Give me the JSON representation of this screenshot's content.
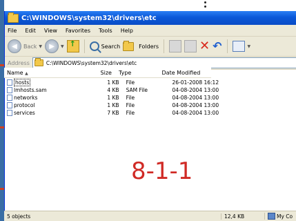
{
  "window": {
    "title": "C:\\WINDOWS\\system32\\drivers\\etc"
  },
  "menu": [
    "File",
    "Edit",
    "View",
    "Favorites",
    "Tools",
    "Help"
  ],
  "toolbar": {
    "back_label": "Back",
    "search_label": "Search",
    "folders_label": "Folders"
  },
  "address": {
    "label": "Address",
    "value": "C:\\WINDOWS\\system32\\drivers\\etc"
  },
  "columns": {
    "name": "Name",
    "size": "Size",
    "type": "Type",
    "date": "Date Modified"
  },
  "files": [
    {
      "name": "hosts",
      "size": "1 KB",
      "type": "File",
      "date": "26-01-2008 16:12"
    },
    {
      "name": "lmhosts.sam",
      "size": "4 KB",
      "type": "SAM File",
      "date": "04-08-2004 13:00"
    },
    {
      "name": "networks",
      "size": "1 KB",
      "type": "File",
      "date": "04-08-2004 13:00"
    },
    {
      "name": "protocol",
      "size": "1 KB",
      "type": "File",
      "date": "04-08-2004 13:00"
    },
    {
      "name": "services",
      "size": "7 KB",
      "type": "File",
      "date": "04-08-2004 13:00"
    }
  ],
  "overlay": {
    "code": "8-1-1"
  },
  "status": {
    "objects": "5 objects",
    "size": "12,4 KB",
    "location": "My Co"
  },
  "colors": {
    "titlebar": "#0a58d8",
    "overlay_text": "#d02a25"
  }
}
